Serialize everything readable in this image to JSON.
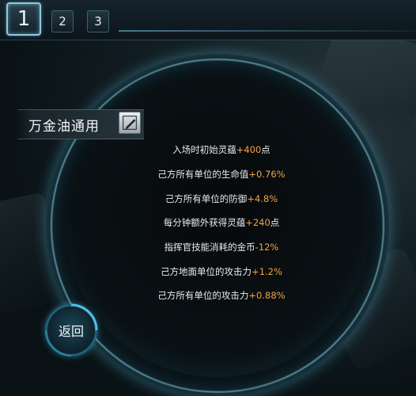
{
  "tabs": [
    {
      "label": "1",
      "active": true
    },
    {
      "label": "2",
      "active": false
    },
    {
      "label": "3",
      "active": false
    }
  ],
  "panel": {
    "name": "万金油通用",
    "edit_icon": "edit-pencil-icon"
  },
  "stats": [
    {
      "label": "入场时初始灵蕴",
      "value": "+400",
      "suffix": "点"
    },
    {
      "label": "己方所有单位的生命值",
      "value": "+0.76%",
      "suffix": ""
    },
    {
      "label": "己方所有单位的防御",
      "value": "+4.8%",
      "suffix": ""
    },
    {
      "label": "每分钟额外获得灵蕴",
      "value": "+240",
      "suffix": "点"
    },
    {
      "label": "指挥官技能消耗的金币",
      "value": "-12%",
      "suffix": ""
    },
    {
      "label": "己方地面单位的攻击力",
      "value": "+1.2%",
      "suffix": ""
    },
    {
      "label": "己方所有单位的攻击力",
      "value": "+0.88%",
      "suffix": ""
    }
  ],
  "back_button": {
    "label": "返回"
  },
  "colors": {
    "value_highlight": "#f0a346",
    "ring_glow": "#61b6cf",
    "text": "#e6ecef"
  }
}
